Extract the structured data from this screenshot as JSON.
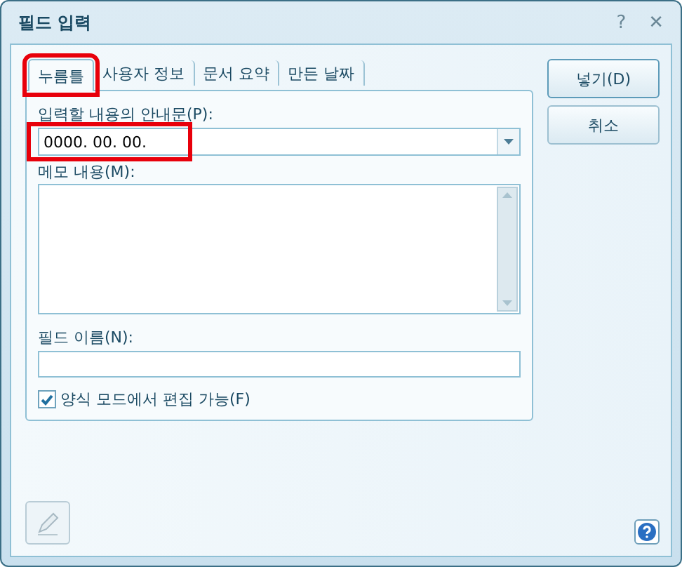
{
  "window": {
    "title": "필드 입력",
    "help_glyph": "?",
    "close_glyph": "✕"
  },
  "tabs": [
    {
      "label": "누름틀",
      "selected": true,
      "highlighted": true
    },
    {
      "label": "사용자 정보",
      "selected": false,
      "highlighted": false
    },
    {
      "label": "문서 요약",
      "selected": false,
      "highlighted": false
    },
    {
      "label": "만든 날짜",
      "selected": false,
      "highlighted": false
    }
  ],
  "form": {
    "prompt_label": "입력할 내용의 안내문(P):",
    "prompt_value": "0000. 00. 00.",
    "prompt_highlighted": true,
    "memo_label": "메모 내용(M):",
    "name_label": "필드 이름(N):",
    "editable": {
      "label": "양식 모드에서 편집 가능(F)",
      "checked": true
    }
  },
  "buttons": [
    {
      "label": "넣기(D)",
      "default": true
    },
    {
      "label": "취소",
      "default": false
    }
  ]
}
